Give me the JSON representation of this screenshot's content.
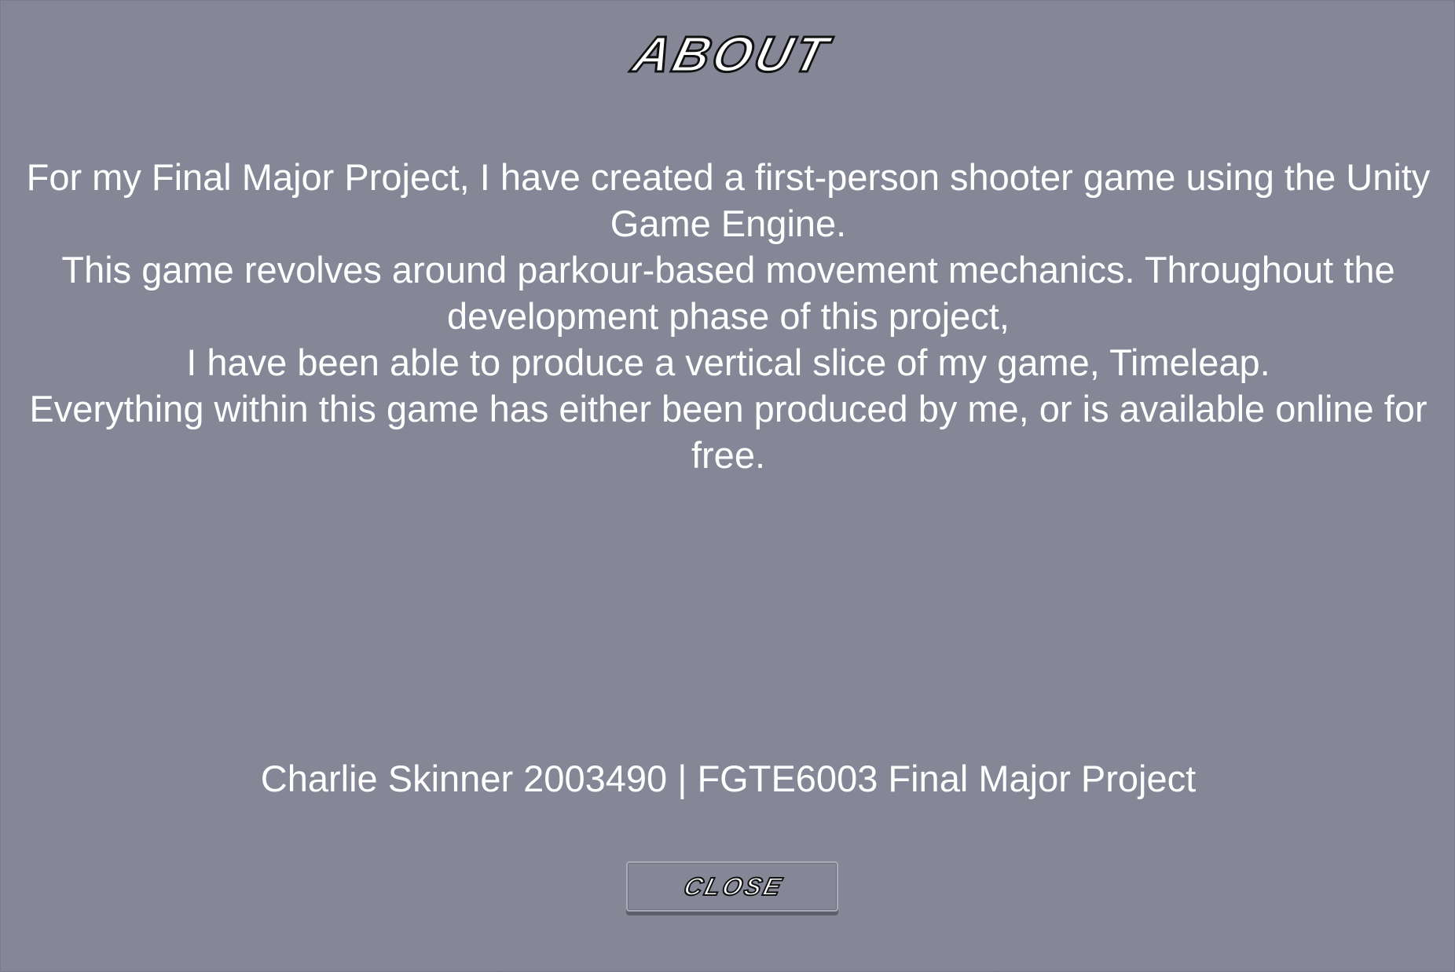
{
  "title": "ABOUT",
  "body_paragraphs": [
    "For my Final Major Project, I have created a first-person shooter game using the Unity Game Engine.",
    "This game revolves around parkour-based movement mechanics. Throughout the development phase of this project,",
    "I have been able to produce a vertical slice of my game, Timeleap.",
    "Everything within this game has either been produced by me, or is available online for free."
  ],
  "credit": "Charlie Skinner 2003490 | FGTE6003 Final Major Project",
  "close_button": {
    "label": "CLOSE"
  },
  "colors": {
    "background": "#858797",
    "text": "#ffffff",
    "title_outline": "#111111"
  }
}
